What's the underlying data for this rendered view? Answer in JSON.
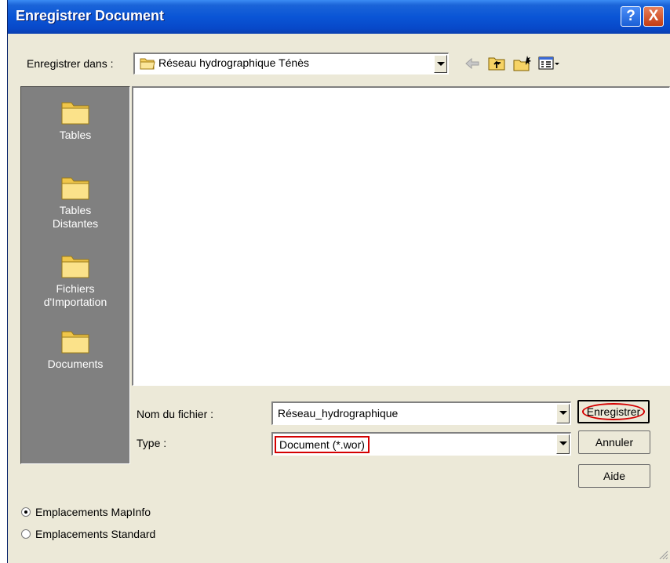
{
  "window": {
    "title": "Enregistrer Document",
    "help_button": "?",
    "close_button": "X"
  },
  "save_in": {
    "label": "Enregistrer dans :",
    "value": "Réseau hydrographique Ténès"
  },
  "toolbar": {
    "back_icon": "back-arrow-icon",
    "up_icon": "up-folder-icon",
    "new_folder_icon": "new-folder-icon",
    "view_menu_icon": "view-menu-icon"
  },
  "places": [
    {
      "label": "Tables",
      "icon": "folder-icon"
    },
    {
      "label": "Tables Distantes",
      "icon": "folder-icon"
    },
    {
      "label": "Fichiers d'Importation",
      "icon": "folder-icon"
    },
    {
      "label": "Documents",
      "icon": "folder-icon"
    }
  ],
  "file_name": {
    "label": "Nom du fichier :",
    "value": "Réseau_hydrographique"
  },
  "file_type": {
    "label": "Type :",
    "value": "Document (*.wor)"
  },
  "buttons": {
    "save": "Enregistrer",
    "cancel": "Annuler",
    "help": "Aide"
  },
  "locations": {
    "mapinfo": "Emplacements MapInfo",
    "standard": "Emplacements Standard",
    "selected": "mapinfo"
  },
  "colors": {
    "title_bar": "#0a55d6",
    "highlight_red": "#d40000",
    "folder_yellow": "#f8dc78"
  }
}
